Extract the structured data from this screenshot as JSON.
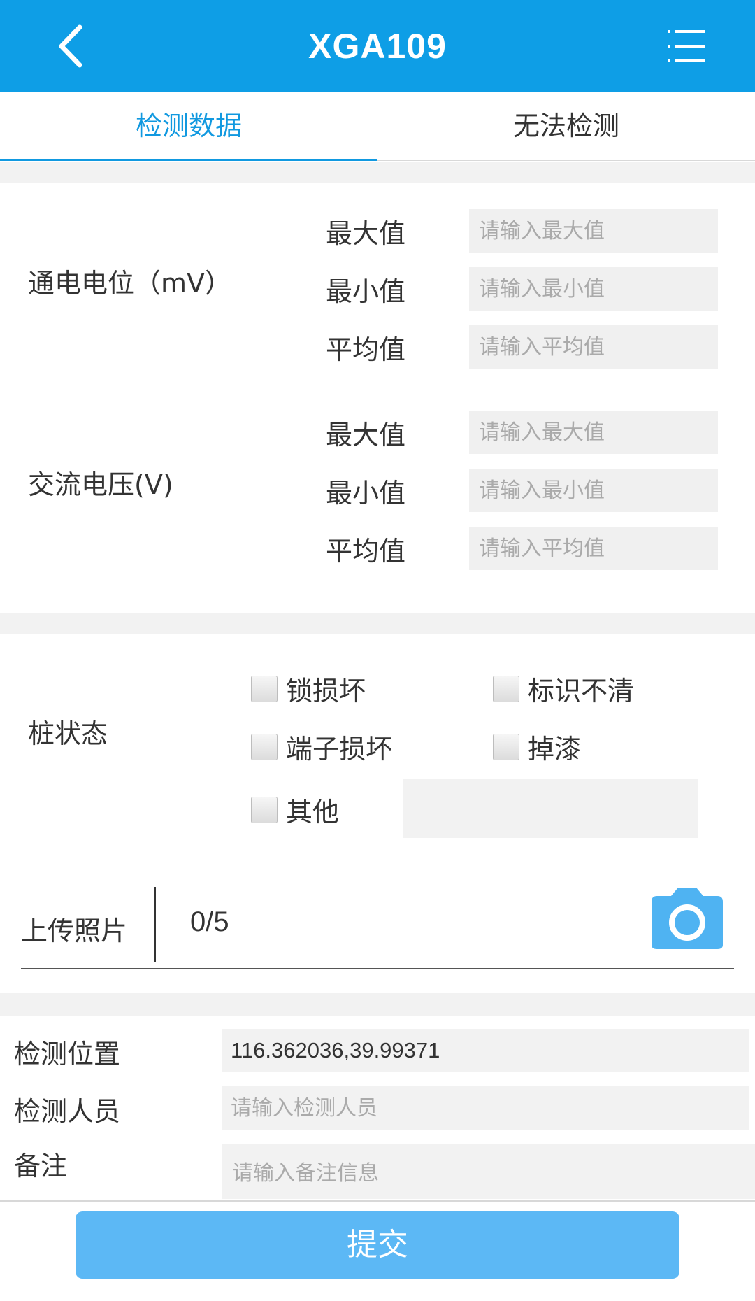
{
  "header": {
    "title": "XGA109",
    "back_icon": "chevron-left-icon",
    "menu_icon": "list-menu-icon",
    "bg_color": "#0e9ee6"
  },
  "tabs": [
    {
      "label": "检测数据",
      "active": true
    },
    {
      "label": "无法检测",
      "active": false
    }
  ],
  "sections": {
    "power_on_potential": {
      "label": "通电电位（mV）",
      "rows": [
        {
          "label": "最大值",
          "placeholder": "请输入最大值"
        },
        {
          "label": "最小值",
          "placeholder": "请输入最小值"
        },
        {
          "label": "平均值",
          "placeholder": "请输入平均值"
        }
      ]
    },
    "ac_voltage": {
      "label": "交流电压(V)",
      "rows": [
        {
          "label": "最大值",
          "placeholder": "请输入最大值"
        },
        {
          "label": "最小值",
          "placeholder": "请输入最小值"
        },
        {
          "label": "平均值",
          "placeholder": "请输入平均值"
        }
      ]
    }
  },
  "pile_status": {
    "label": "桩状态",
    "options": [
      {
        "label": "锁损坏",
        "checked": false
      },
      {
        "label": "标识不清",
        "checked": false
      },
      {
        "label": "端子损坏",
        "checked": false
      },
      {
        "label": "掉漆",
        "checked": false
      },
      {
        "label": "其他",
        "checked": false
      }
    ],
    "other_value": ""
  },
  "upload": {
    "label": "上传照片",
    "count": "0/5",
    "icon": "camera-icon"
  },
  "fields": {
    "location": {
      "label": "检测位置",
      "value": "116.362036,39.99371"
    },
    "inspector": {
      "label": "检测人员",
      "placeholder": "请输入检测人员",
      "value": ""
    },
    "remark": {
      "label": "备注",
      "placeholder": "请输入备注信息",
      "value": ""
    }
  },
  "submit_label": "提交",
  "colors": {
    "accent": "#1199e0",
    "submit_bg": "#5cb8f5",
    "camera": "#4fb3f2"
  }
}
